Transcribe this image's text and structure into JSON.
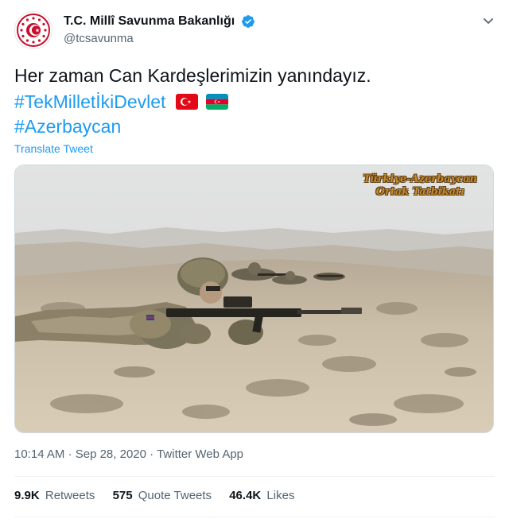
{
  "author": {
    "display_name": "T.C. Millî Savunma Bakanlığı",
    "handle": "@tcsavunma",
    "verified": true,
    "avatar_icon": "turkish-mod-emblem-icon"
  },
  "tweet": {
    "text_line1": "Her zaman Can Kardeşlerimizin yanındayız.",
    "hashtag1": "#TekMilletİkiDevlet",
    "hashtag2": "#Azerbaycan",
    "flags": [
      "turkey-flag-icon",
      "azerbaijan-flag-icon"
    ],
    "translate_label": "Translate Tweet"
  },
  "media": {
    "overlay_line1": "Türkiye-Azerbaycan",
    "overlay_line2": "Ortak Tatbikatı"
  },
  "meta": {
    "time": "10:14 AM",
    "separator": "·",
    "date": "Sep 28, 2020",
    "source": "Twitter Web App"
  },
  "stats": {
    "retweets_count": "9.9K",
    "retweets_label": "Retweets",
    "quotes_count": "575",
    "quotes_label": "Quote Tweets",
    "likes_count": "46.4K",
    "likes_label": "Likes"
  },
  "colors": {
    "link_blue": "#1d9bf0",
    "secondary_text": "#536471",
    "turkey_red": "#e30a17",
    "azerbaijan_blue": "#0092bc",
    "azerbaijan_red": "#e4002b",
    "azerbaijan_green": "#00af66"
  }
}
